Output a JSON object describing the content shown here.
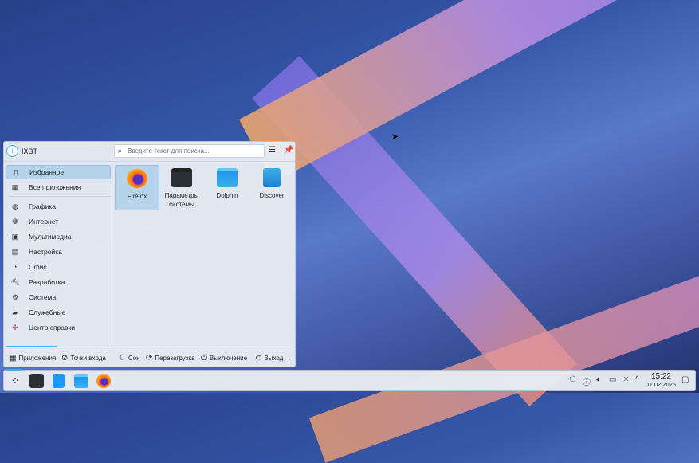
{
  "user": {
    "name": "IXBT"
  },
  "search": {
    "placeholder": "Введите текст для поиска..."
  },
  "sidebar": {
    "items": [
      {
        "label": "Избранное",
        "icon": "bookmark-icon"
      },
      {
        "label": "Все приложения",
        "icon": "grid-icon"
      },
      {
        "label": "Графика",
        "icon": "graphics-icon"
      },
      {
        "label": "Интернет",
        "icon": "globe-icon"
      },
      {
        "label": "Мультимедиа",
        "icon": "multimedia-icon"
      },
      {
        "label": "Настройка",
        "icon": "settings-icon"
      },
      {
        "label": "Офис",
        "icon": "office-icon"
      },
      {
        "label": "Разработка",
        "icon": "development-icon"
      },
      {
        "label": "Система",
        "icon": "system-icon"
      },
      {
        "label": "Служебные",
        "icon": "utilities-icon"
      },
      {
        "label": "Центр справки",
        "icon": "help-icon"
      }
    ]
  },
  "apps": [
    {
      "label": "Firefox"
    },
    {
      "label": "Параметры системы"
    },
    {
      "label": "Dolphin"
    },
    {
      "label": "Discover"
    }
  ],
  "footer": {
    "applications": "Приложения",
    "places": "Точки входа",
    "sleep": "Сон",
    "restart": "Перезагрузка",
    "shutdown": "Выключение",
    "logout": "Выход"
  },
  "clock": {
    "time": "15:22",
    "date": "11.02.2025"
  },
  "colors": {
    "accent": "#3daee9"
  }
}
